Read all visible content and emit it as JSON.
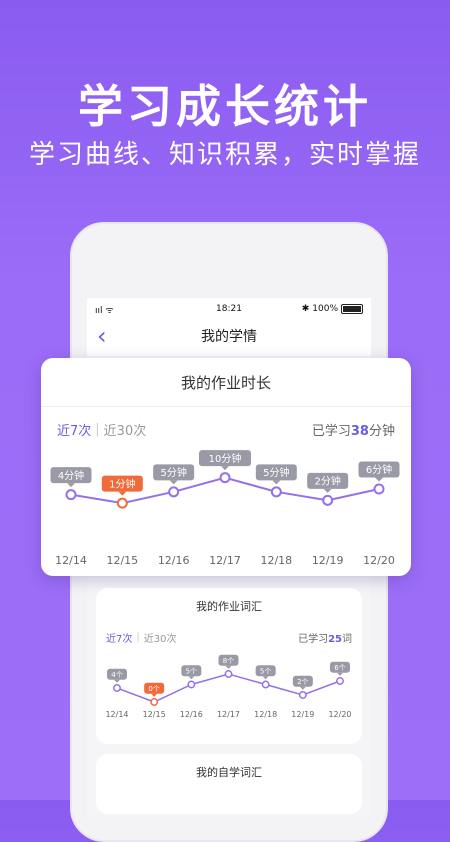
{
  "hero": {
    "title": "学习成长统计",
    "subtitle": "学习曲线、知识积累，实时掌握"
  },
  "status_bar": {
    "signal": "ııl ᯤ",
    "time": "18:21",
    "bluetooth": "✱",
    "battery": "100%"
  },
  "nav": {
    "back_icon": "chevron-left-icon",
    "title": "我的学情"
  },
  "colors": {
    "accent": "#7b5be6",
    "highlight": "#f06a3a",
    "bubble": "#9a9aa6",
    "line": "#9470ea"
  },
  "homework_time": {
    "title": "我的作业时长",
    "range_7": "近7次",
    "range_30": "近30次",
    "range_sep": "|",
    "learned_prefix": "已学习",
    "learned_value": "38",
    "learned_suffix": "分钟",
    "chart_data": {
      "type": "line",
      "categories": [
        "12/14",
        "12/15",
        "12/16",
        "12/17",
        "12/18",
        "12/19",
        "12/20"
      ],
      "values": [
        4,
        1,
        5,
        10,
        5,
        2,
        6
      ],
      "labels": [
        "4分钟",
        "1分钟",
        "5分钟",
        "10分钟",
        "5分钟",
        "2分钟",
        "6分钟"
      ],
      "highlight_index": 1,
      "ylim": [
        0,
        12
      ]
    }
  },
  "homework_words": {
    "title": "我的作业词汇",
    "range_7": "近7次",
    "range_30": "近30次",
    "range_sep": "|",
    "learned_prefix": "已学习",
    "learned_value": "25",
    "learned_suffix": "词",
    "chart_data": {
      "type": "line",
      "categories": [
        "12/14",
        "12/15",
        "12/16",
        "12/17",
        "12/18",
        "12/19",
        "12/20"
      ],
      "values": [
        4,
        0,
        5,
        8,
        5,
        2,
        6
      ],
      "labels": [
        "4个",
        "0个",
        "5个",
        "8个",
        "5个",
        "2个",
        "6个"
      ],
      "highlight_index": 1,
      "ylim": [
        0,
        12
      ]
    }
  },
  "self_study_words": {
    "title": "我的自学词汇"
  }
}
